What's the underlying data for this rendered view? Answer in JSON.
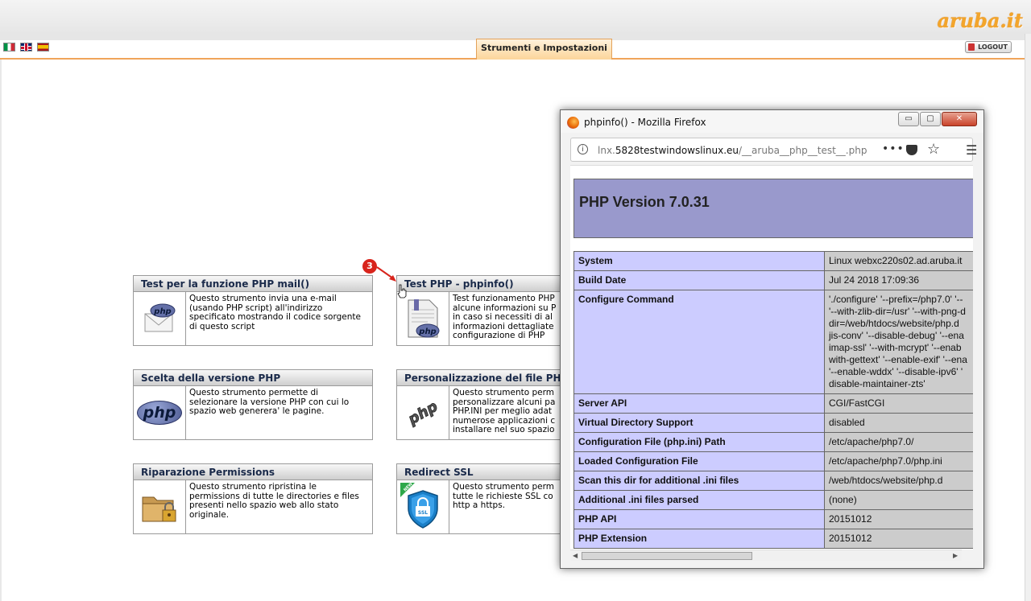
{
  "header": {
    "logo_text": "aruba.it",
    "active_tab": "Strumenti e Impostazioni",
    "logout_label": "LOGOUT",
    "flags": [
      "flag-it-icon",
      "flag-uk-icon",
      "flag-es-icon"
    ]
  },
  "tools": [
    {
      "title": "Test per la funzione PHP mail()",
      "description": "Questo strumento invia una e-mail (usando PHP script) all'indirizzo specificato mostrando il codice sorgente di questo script",
      "icon": "php-mail-icon"
    },
    {
      "title": "Test PHP - phpinfo()",
      "description": "Test funzionamento PHP alcune informazioni su P in caso si necessiti di al informazioni dettagliate configurazione di PHP",
      "icon": "php-document-icon"
    },
    {
      "title": "Scelta della versione PHP",
      "description": "Questo strumento permette di selezionare la versione PHP con cui lo spazio web generera' le pagine.",
      "icon": "php-logo-icon"
    },
    {
      "title": "Personalizzazione del file PHP",
      "description": "Questo strumento perm personalizzare alcuni pa PHP.INI per meglio adat numerose applicazioni c installare nel suo spazio",
      "icon": "php-ini-icon"
    },
    {
      "title": "Riparazione Permissions",
      "description": "Questo strumento ripristina le permissions di tutte le directories e files presenti nello spazio web allo stato originale.",
      "icon": "folder-lock-icon"
    },
    {
      "title": "Redirect SSL",
      "description": "Questo strumento perm tutte le richieste SSL co http a https.",
      "icon": "ssl-shield-icon",
      "badge": "NEW"
    }
  ],
  "annotation": {
    "step_number": "3"
  },
  "icons": {
    "php_text": "php",
    "ssl_text": "SSL"
  },
  "firefox": {
    "window_title": "phpinfo() - Mozilla Firefox",
    "url_prefix": "lnx.",
    "url_host": "5828testwindowslinux.eu",
    "url_path": "/__aruba__php__test__.php",
    "buttons": {
      "min": "▭",
      "max": "▢",
      "close": "✕"
    },
    "more_label": "•••",
    "star_label": "☆",
    "menu_label": "☰"
  },
  "phpinfo": {
    "version_title": "PHP Version 7.0.31",
    "rows": [
      {
        "key": "System",
        "value": "Linux webxc220s02.ad.aruba.it"
      },
      {
        "key": "Build Date",
        "value": "Jul 24 2018 17:09:36"
      },
      {
        "key": "Configure Command",
        "value": "'./configure' '--prefix=/php7.0' '--\n'--with-zlib-dir=/usr' '--with-png-d\ndir=/web/htdocs/website/php.d\njis-conv' '--disable-debug' '--ena\nimap-ssl' '--with-mcrypt' '--enab\nwith-gettext' '--enable-exif' '--ena\n'--enable-wddx' '--disable-ipv6' '\ndisable-maintainer-zts'"
      },
      {
        "key": "Server API",
        "value": "CGI/FastCGI"
      },
      {
        "key": "Virtual Directory Support",
        "value": "disabled"
      },
      {
        "key": "Configuration File (php.ini) Path",
        "value": "/etc/apache/php7.0/"
      },
      {
        "key": "Loaded Configuration File",
        "value": "/etc/apache/php7.0/php.ini"
      },
      {
        "key": "Scan this dir for additional .ini files",
        "value": "/web/htdocs/website/php.d"
      },
      {
        "key": "Additional .ini files parsed",
        "value": "(none)"
      },
      {
        "key": "PHP API",
        "value": "20151012"
      },
      {
        "key": "PHP Extension",
        "value": "20151012"
      }
    ]
  }
}
